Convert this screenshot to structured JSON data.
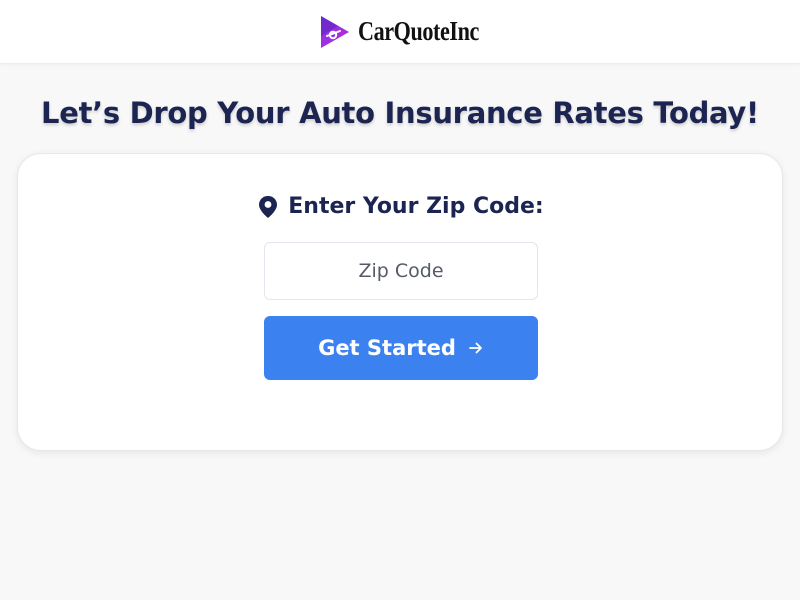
{
  "header": {
    "logo_text": "CarQuoteInc",
    "logo_icon": "play-car-logo-icon",
    "logo_colors": [
      "#6d28d9",
      "#b026c9"
    ]
  },
  "hero": {
    "headline": "Let’s Drop Your Auto Insurance Rates Today!"
  },
  "form": {
    "zip_label": "Enter Your Zip Code:",
    "zip_icon": "map-pin-icon",
    "zip_placeholder": "Zip Code",
    "zip_value": "",
    "cta_label": "Get Started",
    "cta_icon": "arrow-right-icon"
  },
  "colors": {
    "navy_text": "#1c2452",
    "cta_blue": "#3b82f0",
    "page_bg": "#f8f8f8"
  }
}
